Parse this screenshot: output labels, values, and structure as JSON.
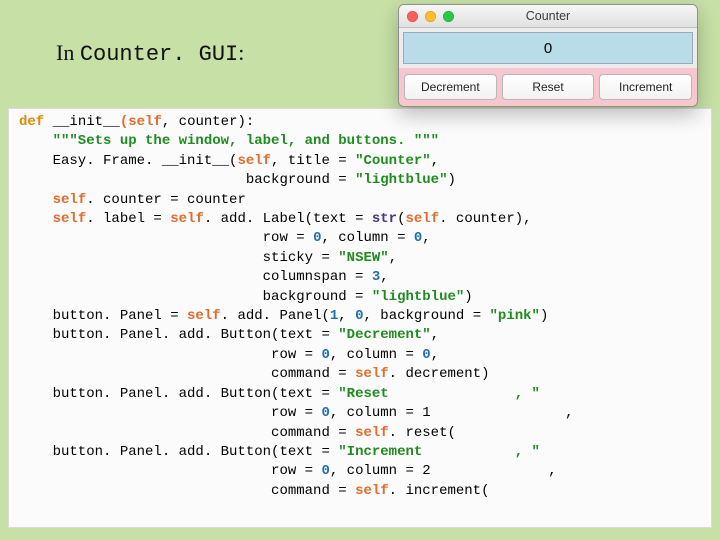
{
  "heading_prefix": "In ",
  "heading_classname": "Counter. GUI",
  "heading_suffix": ":",
  "window": {
    "title": "Counter",
    "counter_value": "0",
    "buttons": {
      "dec": "Decrement",
      "reset": "Reset",
      "inc": "Increment"
    }
  },
  "code": {
    "l01_def": "def",
    "l01_name": " __init__",
    "l01_self": "(self",
    "l01_rest": ", counter):",
    "l02": "    \"\"\"Sets up the window, label, and buttons. \"\"\"",
    "l03a": "    Easy. Frame. __init__(",
    "l03_self": "self",
    "l03b": ", title = ",
    "l03_str": "\"Counter\"",
    "l03c": ",",
    "l04a": "                           background = ",
    "l04_str": "\"lightblue\"",
    "l04b": ")",
    "l05a": "    ",
    "l05_self1": "self",
    "l05b": ". counter = counter",
    "l06a": "    ",
    "l06_self1": "self",
    "l06b": ". label = ",
    "l06_self2": "self",
    "l06c": ". add. Label(text = ",
    "l06_fn": "str",
    "l06d": "(",
    "l06_self3": "self",
    "l06e": ". counter),",
    "l07a": "                             row = ",
    "l07_n1": "0",
    "l07b": ", column = ",
    "l07_n2": "0",
    "l07c": ",",
    "l08a": "                             sticky = ",
    "l08_str": "\"NSEW\"",
    "l08b": ",",
    "l09a": "                             columnspan = ",
    "l09_n": "3",
    "l09b": ",",
    "l10a": "                             background = ",
    "l10_str": "\"lightblue\"",
    "l10b": ")",
    "l11a": "    button. Panel = ",
    "l11_self": "self",
    "l11b": ". add. Panel(",
    "l11_n1": "1",
    "l11c": ", ",
    "l11_n2": "0",
    "l11d": ", background = ",
    "l11_str": "\"pink\"",
    "l11e": ")",
    "l12a": "    button. Panel. add. Button(text = ",
    "l12_str": "\"Decrement\"",
    "l12b": ",",
    "l13a": "                              row = ",
    "l13_n1": "0",
    "l13b": ", column = ",
    "l13_n2": "0",
    "l13c": ",",
    "l14a": "                              command = ",
    "l14_self": "self",
    "l14b": ". decrement)",
    "l15a": "    button. Panel. add. Button(text = ",
    "l15_str": "\"Reset               , \"",
    "l16a": "                              row = ",
    "l16_n1": "0",
    "l16b": ", column = ",
    "l16_n2": "1                ,",
    "l17a": "                              command = ",
    "l17_self": "self",
    "l17b": ". reset(",
    "l18a": "    button. Panel. add. Button(text = ",
    "l18_str": "\"Increment           , \"",
    "l19a": "                              row = ",
    "l19_n1": "0",
    "l19b": ", column = ",
    "l19_n2": "2              ,",
    "l20a": "                              command = ",
    "l20_self": "self",
    "l20b": ". increment("
  }
}
